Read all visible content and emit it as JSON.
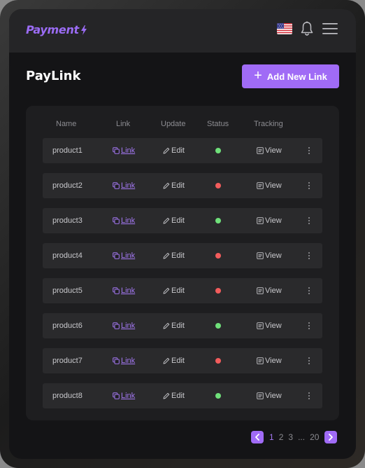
{
  "brand": {
    "name": "Payment",
    "accent": "#9b6cf5"
  },
  "header": {
    "flag_icon": "us-flag-icon",
    "bell_icon": "bell-icon",
    "menu_icon": "hamburger-menu-icon"
  },
  "page": {
    "title": "PayLink"
  },
  "toolbar": {
    "add_label": "Add New Link"
  },
  "table": {
    "columns": [
      "Name",
      "Link",
      "Update",
      "Status",
      "Tracking"
    ],
    "rows": [
      {
        "name": "product1",
        "link": "Link",
        "edit": "Edit",
        "status": "active",
        "view": "View"
      },
      {
        "name": "product2",
        "link": "Link",
        "edit": "Edit",
        "status": "inactive",
        "view": "View"
      },
      {
        "name": "product3",
        "link": "Link",
        "edit": "Edit",
        "status": "active",
        "view": "View"
      },
      {
        "name": "product4",
        "link": "Link",
        "edit": "Edit",
        "status": "inactive",
        "view": "View"
      },
      {
        "name": "product5",
        "link": "Link",
        "edit": "Edit",
        "status": "inactive",
        "view": "View"
      },
      {
        "name": "product6",
        "link": "Link",
        "edit": "Edit",
        "status": "active",
        "view": "View"
      },
      {
        "name": "product7",
        "link": "Link",
        "edit": "Edit",
        "status": "inactive",
        "view": "View"
      },
      {
        "name": "product8",
        "link": "Link",
        "edit": "Edit",
        "status": "active",
        "view": "View"
      }
    ]
  },
  "status_colors": {
    "active": "#6fe07a",
    "inactive": "#f25c5c"
  },
  "pagination": {
    "pages": [
      "1",
      "2",
      "3",
      "...",
      "20"
    ],
    "current": "1"
  }
}
